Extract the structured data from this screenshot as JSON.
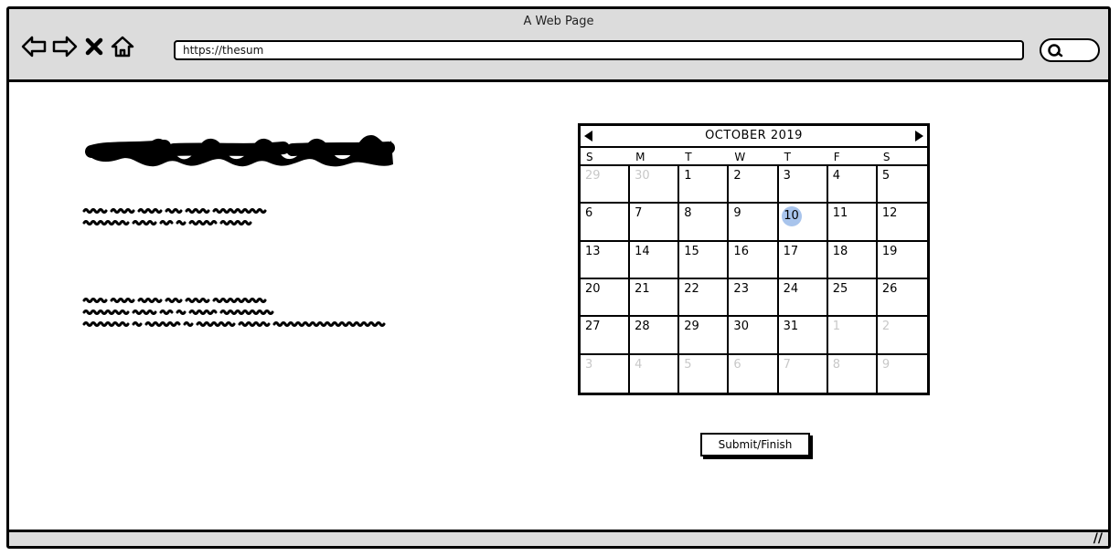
{
  "browser": {
    "title": "A Web Page",
    "url": "https://thesum",
    "icons": [
      "back-arrow-icon",
      "forward-arrow-icon",
      "close-icon",
      "home-icon",
      "search-icon"
    ]
  },
  "calendar": {
    "month_label": "OCTOBER 2019",
    "weekdays": [
      "S",
      "M",
      "T",
      "W",
      "T",
      "F",
      "S"
    ],
    "selected_day": "10",
    "selected_color": "#a8c4ec",
    "days": [
      {
        "label": "29",
        "muted": true
      },
      {
        "label": "30",
        "muted": true
      },
      {
        "label": "1"
      },
      {
        "label": "2"
      },
      {
        "label": "3"
      },
      {
        "label": "4"
      },
      {
        "label": "5"
      },
      {
        "label": "6"
      },
      {
        "label": "7"
      },
      {
        "label": "8"
      },
      {
        "label": "9"
      },
      {
        "label": "10",
        "selected": true
      },
      {
        "label": "11"
      },
      {
        "label": "12"
      },
      {
        "label": "13"
      },
      {
        "label": "14"
      },
      {
        "label": "15"
      },
      {
        "label": "16"
      },
      {
        "label": "17"
      },
      {
        "label": "18"
      },
      {
        "label": "19"
      },
      {
        "label": "20"
      },
      {
        "label": "21"
      },
      {
        "label": "22"
      },
      {
        "label": "23"
      },
      {
        "label": "24"
      },
      {
        "label": "25"
      },
      {
        "label": "26"
      },
      {
        "label": "27"
      },
      {
        "label": "28"
      },
      {
        "label": "29"
      },
      {
        "label": "30"
      },
      {
        "label": "31"
      },
      {
        "label": "1",
        "muted": true
      },
      {
        "label": "2",
        "muted": true
      },
      {
        "label": "3",
        "muted": true
      },
      {
        "label": "4",
        "muted": true
      },
      {
        "label": "5",
        "muted": true
      },
      {
        "label": "6",
        "muted": true
      },
      {
        "label": "7",
        "muted": true
      },
      {
        "label": "8",
        "muted": true
      },
      {
        "label": "9",
        "muted": true
      }
    ]
  },
  "actions": {
    "submit_label": "Submit/Finish"
  }
}
